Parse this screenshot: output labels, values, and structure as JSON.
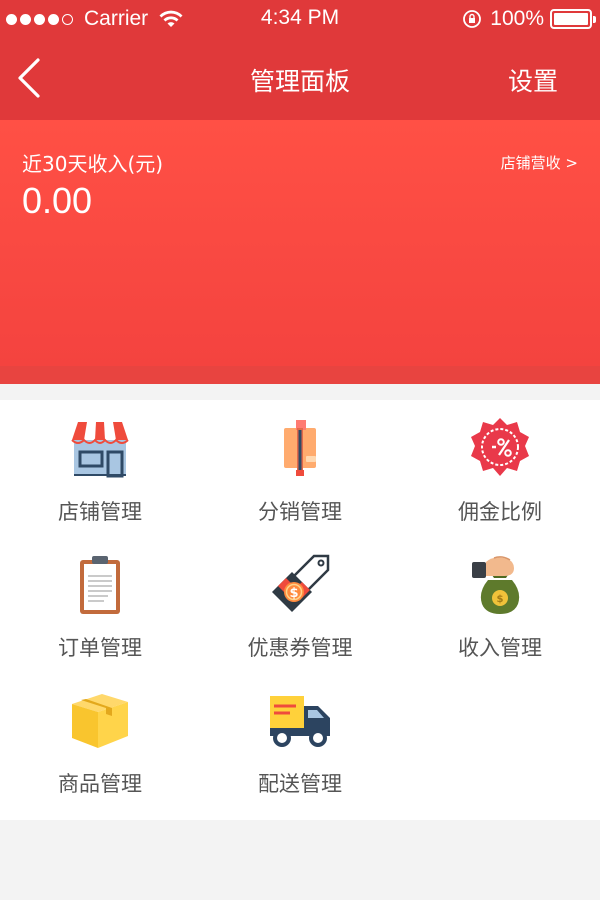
{
  "status_bar": {
    "carrier": "Carrier",
    "time": "4:34 PM",
    "battery": "100%",
    "battery_level": 1.0,
    "signal_bars": 4
  },
  "nav": {
    "title": "管理面板",
    "settings_label": "设置"
  },
  "income": {
    "label": "近30天收入(元)",
    "value": "0.00",
    "store_revenue_link": "店铺营收 >"
  },
  "menu": [
    {
      "label": "店铺管理",
      "icon": "storefront-icon"
    },
    {
      "label": "分销管理",
      "icon": "distribution-icon"
    },
    {
      "label": "佣金比例",
      "icon": "percent-badge-icon"
    },
    {
      "label": "订单管理",
      "icon": "clipboard-icon"
    },
    {
      "label": "优惠券管理",
      "icon": "coupon-tag-icon"
    },
    {
      "label": "收入管理",
      "icon": "money-bag-icon"
    },
    {
      "label": "商品管理",
      "icon": "box-icon"
    },
    {
      "label": "配送管理",
      "icon": "delivery-truck-icon"
    }
  ],
  "colors": {
    "header": "#e0393a",
    "banner": "#ff5045",
    "text_gray": "#555555"
  }
}
